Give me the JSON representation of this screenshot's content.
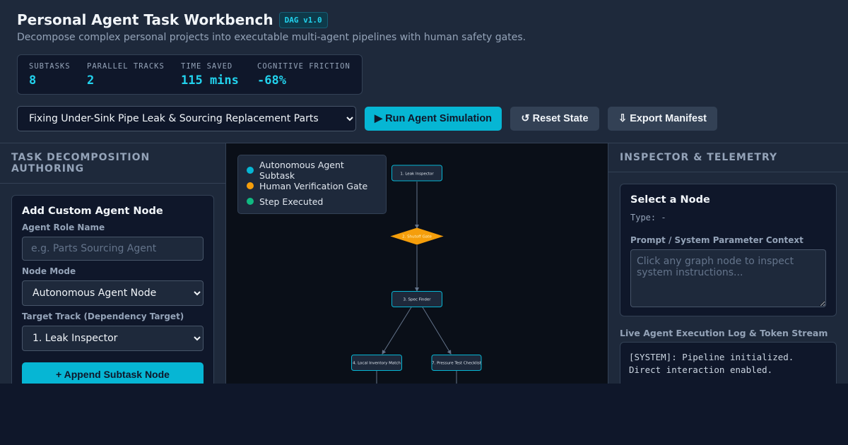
{
  "header": {
    "title": "Personal Agent Task Workbench",
    "badge": "DAG v1.0",
    "subtitle": "Decompose complex personal projects into executable multi-agent pipelines with human safety gates."
  },
  "stats": [
    {
      "label": "SUBTASKS",
      "value": "8"
    },
    {
      "label": "PARALLEL TRACKS",
      "value": "2"
    },
    {
      "label": "TIME SAVED",
      "value": "115 mins"
    },
    {
      "label": "COGNITIVE FRICTION",
      "value": "-68%"
    }
  ],
  "toolbar": {
    "project_selected": "Fixing Under-Sink Pipe Leak & Sourcing Replacement Parts",
    "run_label": "▶ Run Agent Simulation",
    "reset_label": "↺ Reset State",
    "export_label": "⇩ Export Manifest"
  },
  "left_panel": {
    "header": "TASK DECOMPOSITION AUTHORING",
    "card_title": "Add Custom Agent Node",
    "role_label": "Agent Role Name",
    "role_placeholder": "e.g. Parts Sourcing Agent",
    "mode_label": "Node Mode",
    "mode_selected": "Autonomous Agent Node",
    "target_label": "Target Track (Dependency Target)",
    "target_selected": "1. Leak Inspector",
    "append_label": "+ Append Subtask Node"
  },
  "legend": [
    {
      "label": "Autonomous Agent Subtask",
      "color": "#06b6d4"
    },
    {
      "label": "Human Verification Gate",
      "color": "#f59e0b"
    },
    {
      "label": "Step Executed",
      "color": "#10b981"
    }
  ],
  "graph": {
    "nodes": [
      {
        "label": "1. Leak Inspector",
        "kind": "agent"
      },
      {
        "label": "2. Shutoff Gate",
        "kind": "gate"
      },
      {
        "label": "3. Spec Finder",
        "kind": "agent"
      },
      {
        "label": "4. Local Inventory Match",
        "kind": "agent"
      },
      {
        "label": "7. Pressure Test Checklist",
        "kind": "agent"
      }
    ]
  },
  "right_panel": {
    "header": "INSPECTOR & TELEMETRY",
    "inspector_title": "Select a Node",
    "type_text": "Type: -",
    "prompt_label": "Prompt / System Parameter Context",
    "prompt_placeholder": "Click any graph node to inspect system instructions...",
    "log_label": "Live Agent Execution Log & Token Stream",
    "log_lines": [
      "[SYSTEM]: Pipeline initialized.",
      "Direct interaction enabled."
    ]
  }
}
